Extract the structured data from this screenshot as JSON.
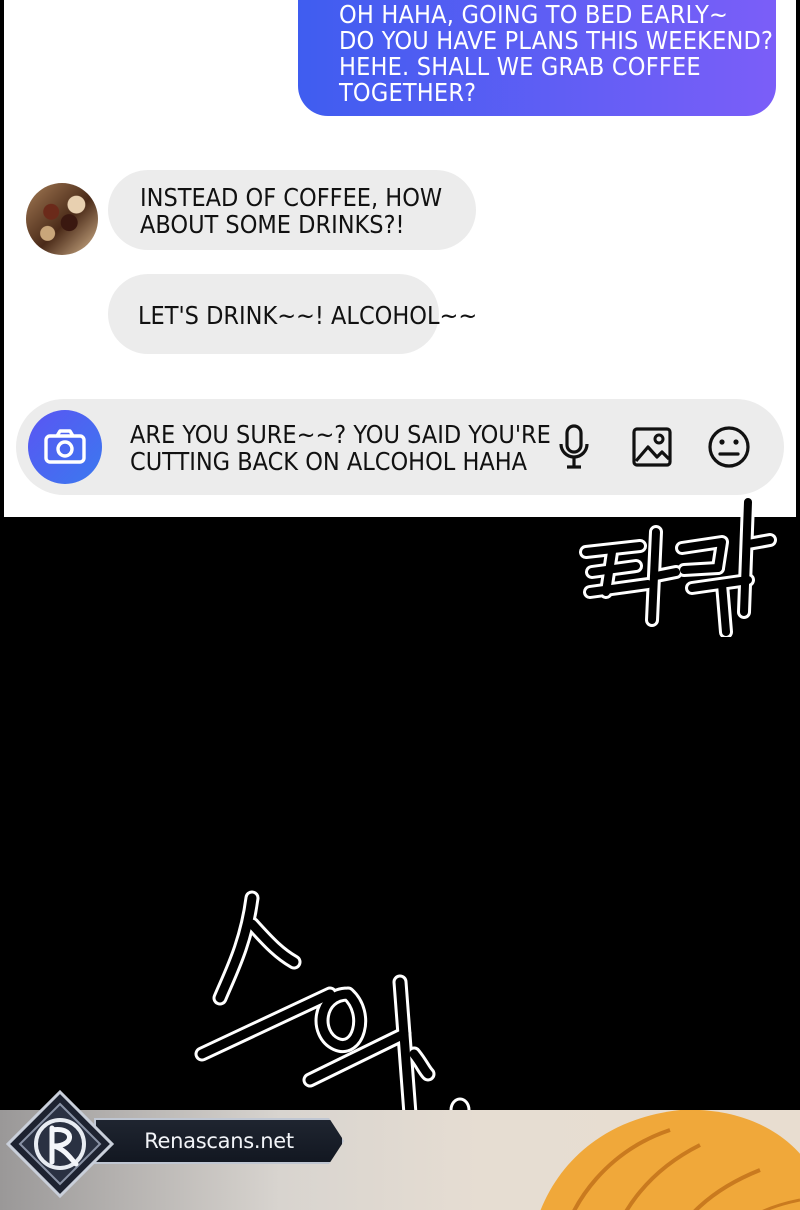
{
  "chat": {
    "sent_message_lines": [
      "OH HAHA, GOING TO BED EARLY~",
      "DO YOU HAVE PLANS THIS WEEKEND?",
      "HEHE. SHALL WE GRAB COFFEE",
      "TOGETHER?"
    ],
    "received_messages": [
      {
        "lines": [
          "INSTEAD OF COFFEE, HOW",
          "ABOUT SOME DRINKS?!"
        ]
      },
      {
        "lines": [
          "LET'S DRINK~~! ALCOHOL~~"
        ]
      }
    ],
    "avatar_icon": "profile-photo",
    "accent_gradient": [
      "#3f5df0",
      "#7b5ef8"
    ],
    "received_bubble_color": "#ececec"
  },
  "input_bar": {
    "draft_lines": [
      "ARE YOU SURE~~? YOU SAID YOU'RE",
      "CUTTING BACK ON ALCOHOL HAHA"
    ],
    "icons": [
      "camera-icon",
      "microphone-icon",
      "image-icon",
      "emoji-icon"
    ]
  },
  "sound_effects": [
    {
      "text": "타닥",
      "icon": "sfx-tadak"
    },
    {
      "text": "스윽..",
      "icon": "sfx-seueuk"
    }
  ],
  "watermark": {
    "text": "Renascans.net",
    "logo_letter": "R"
  }
}
